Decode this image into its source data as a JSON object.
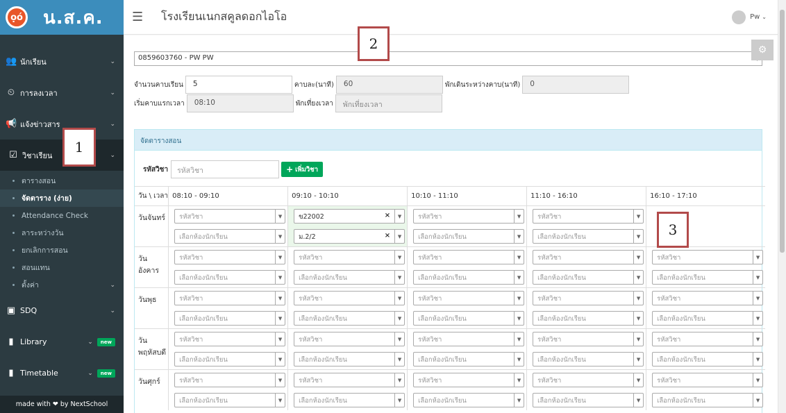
{
  "brand": {
    "logo_text": "ọó",
    "title": "น.ส.ค."
  },
  "sidebar": {
    "items": [
      {
        "icon": "users-icon",
        "glyph": "👥",
        "label": "นักเรียน"
      },
      {
        "icon": "clock-icon",
        "glyph": "⏲",
        "label": "การลงเวลา"
      },
      {
        "icon": "megaphone-icon",
        "glyph": "📢",
        "label": "แจ้งข่าวสาร"
      },
      {
        "icon": "calendar-check-icon",
        "glyph": "☑",
        "label": "วิชาเรียน"
      },
      {
        "icon": "sdq-icon",
        "glyph": "▣",
        "label": "SDQ"
      },
      {
        "icon": "book-icon",
        "glyph": "▮",
        "label": "Library",
        "badge": "new"
      },
      {
        "icon": "timetable-icon",
        "glyph": "▮",
        "label": "Timetable",
        "badge": "new"
      }
    ],
    "subitems": [
      "ตารางสอน",
      "จัดตาราง (ง่าย)",
      "Attendance Check",
      "ลาระหว่างวัน",
      "ยกเลิกการสอน",
      "สอนแทน",
      "ตั้งค่า"
    ],
    "footer": {
      "prefix": "made with",
      "suffix": "by NextSchool"
    }
  },
  "header": {
    "school_name": "โรงเรียนเนกสคูลดอกไอโอ",
    "user": "Pw"
  },
  "teacher_select": {
    "value": "0859603760 - PW PW"
  },
  "form": {
    "periods_label": "จำนวนคาบเรียน",
    "periods_value": "5",
    "minutes_label": "คาบละ(นาที)",
    "minutes_value": "60",
    "break_label": "พักเดินระหว่างคาบ(นาที)",
    "break_value": "0",
    "start_label": "เริ่มคาบแรกเวลา",
    "start_value": "08:10",
    "lunch_label": "พักเที่ยงเวลา",
    "lunch_placeholder": "พักเที่ยงเวลา"
  },
  "panel": {
    "heading": "จัดตารางสอน",
    "subject_code_label": "รหัสวิชา",
    "subject_code_placeholder": "รหัสวิชา",
    "add_button": "เพิ่มวิชา"
  },
  "schedule": {
    "corner": "วัน \\ เวลา",
    "slots": [
      "08:10 - 09:10",
      "09:10 - 10:10",
      "10:10 - 11:10",
      "11:10 - 16:10",
      "16:10 - 17:10"
    ],
    "days": [
      "วันจันทร์",
      "วันอังคาร",
      "วันพุธ",
      "วัน พฤหัสบดี",
      "วันศุกร์"
    ],
    "subject_placeholder": "รหัสวิชา",
    "class_placeholder": "เลือกห้องนักเรียน",
    "filled": {
      "subject": "ข22002",
      "class": "ม.2/2"
    }
  },
  "annotations": [
    "1",
    "2",
    "3"
  ],
  "colors": {
    "sidebar": "#2c3b41",
    "brand": "#3c8dbc",
    "green": "#00a65a",
    "panel_head": "#d9edf7",
    "annotation": "#b24a4a"
  }
}
